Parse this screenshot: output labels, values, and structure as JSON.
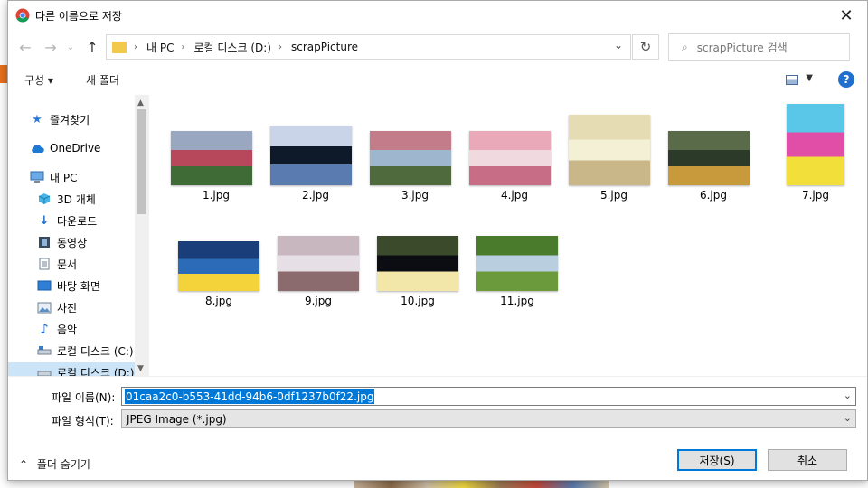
{
  "window": {
    "title": "다른 이름으로 저장",
    "close_symbol": "✕"
  },
  "nav": {
    "back_symbol": "←",
    "forward_symbol": "→",
    "recent_symbol": "⌄",
    "up_symbol": "↑",
    "breadcrumbs": [
      "내 PC",
      "로컬 디스크 (D:)",
      "scrapPicture"
    ],
    "refresh_symbol": "↻",
    "search_placeholder": "scrapPicture 검색"
  },
  "toolbar": {
    "organize_label": "구성 ▾",
    "new_folder_label": "새 폴더",
    "help_label": "?"
  },
  "sidebar": {
    "items": [
      {
        "label": "즐겨찾기",
        "icon": "star-icon"
      },
      {
        "label": "OneDrive",
        "icon": "cloud-icon"
      },
      {
        "label": "내 PC",
        "icon": "computer-icon"
      },
      {
        "label": "3D 개체",
        "icon": "cube-icon"
      },
      {
        "label": "다운로드",
        "icon": "download-icon"
      },
      {
        "label": "동영상",
        "icon": "film-icon"
      },
      {
        "label": "문서",
        "icon": "document-icon"
      },
      {
        "label": "바탕 화면",
        "icon": "desktop-icon"
      },
      {
        "label": "사진",
        "icon": "picture-icon"
      },
      {
        "label": "음악",
        "icon": "music-icon"
      },
      {
        "label": "로컬 디스크 (C:)",
        "icon": "drive-icon"
      },
      {
        "label": "로컬 디스크 (D:)",
        "icon": "drive-icon"
      }
    ]
  },
  "files": [
    {
      "name": "1.jpg",
      "colors": [
        "#b7475a",
        "#3f6b37",
        "#9aa7c0"
      ]
    },
    {
      "name": "2.jpg",
      "colors": [
        "#0e1a2a",
        "#5a7bb0",
        "#c9d4e8"
      ]
    },
    {
      "name": "3.jpg",
      "colors": [
        "#9fb6cf",
        "#4f6b3e",
        "#c27c8a"
      ]
    },
    {
      "name": "4.jpg",
      "colors": [
        "#f0d9df",
        "#c86d86",
        "#e9a9b9"
      ]
    },
    {
      "name": "5.jpg",
      "colors": [
        "#f4f0d6",
        "#c9b78a",
        "#e6dcb3"
      ]
    },
    {
      "name": "6.jpg",
      "colors": [
        "#2c3a2a",
        "#c89a3c",
        "#5a6b4a"
      ]
    },
    {
      "name": "7.jpg",
      "colors": [
        "#e04ea8",
        "#f3df3a",
        "#5ac7e8"
      ]
    },
    {
      "name": "8.jpg",
      "colors": [
        "#2b6bb7",
        "#f4d33a",
        "#1a3e7a"
      ]
    },
    {
      "name": "9.jpg",
      "colors": [
        "#e7dfe6",
        "#8c6b6e",
        "#c9b7c0"
      ]
    },
    {
      "name": "10.jpg",
      "colors": [
        "#0b0d12",
        "#f2e6a8",
        "#3a4a2a"
      ]
    },
    {
      "name": "11.jpg",
      "colors": [
        "#b9cfe0",
        "#6a9a3c",
        "#4a7a2c"
      ]
    }
  ],
  "form": {
    "filename_label": "파일 이름(N):",
    "filename_value": "01caa2c0-b553-41dd-94b6-0df1237b0f22.jpg",
    "type_label": "파일 형식(T):",
    "type_value": "JPEG Image (*.jpg)"
  },
  "footer": {
    "hide_folders_label": "폴더 숨기기",
    "save_label": "저장(S)",
    "cancel_label": "취소"
  }
}
